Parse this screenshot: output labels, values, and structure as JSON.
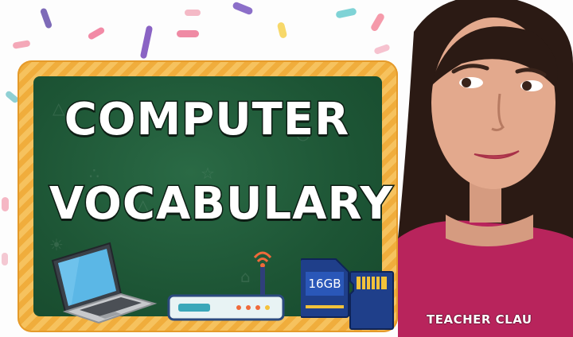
{
  "thumbnail": {
    "title_line_1": "COMPUTER",
    "title_line_2": "VOCABULARY",
    "channel_tag": "TEACHER CLAU",
    "memory_card_label": "16GB"
  },
  "colors": {
    "board": "#1d5535",
    "frame": "#f0ad3c",
    "shirt": "#b8245c",
    "hair": "#2b1a14"
  },
  "icons": [
    "laptop-icon",
    "router-icon",
    "sd-card-icon",
    "micro-sd-card-icon"
  ]
}
